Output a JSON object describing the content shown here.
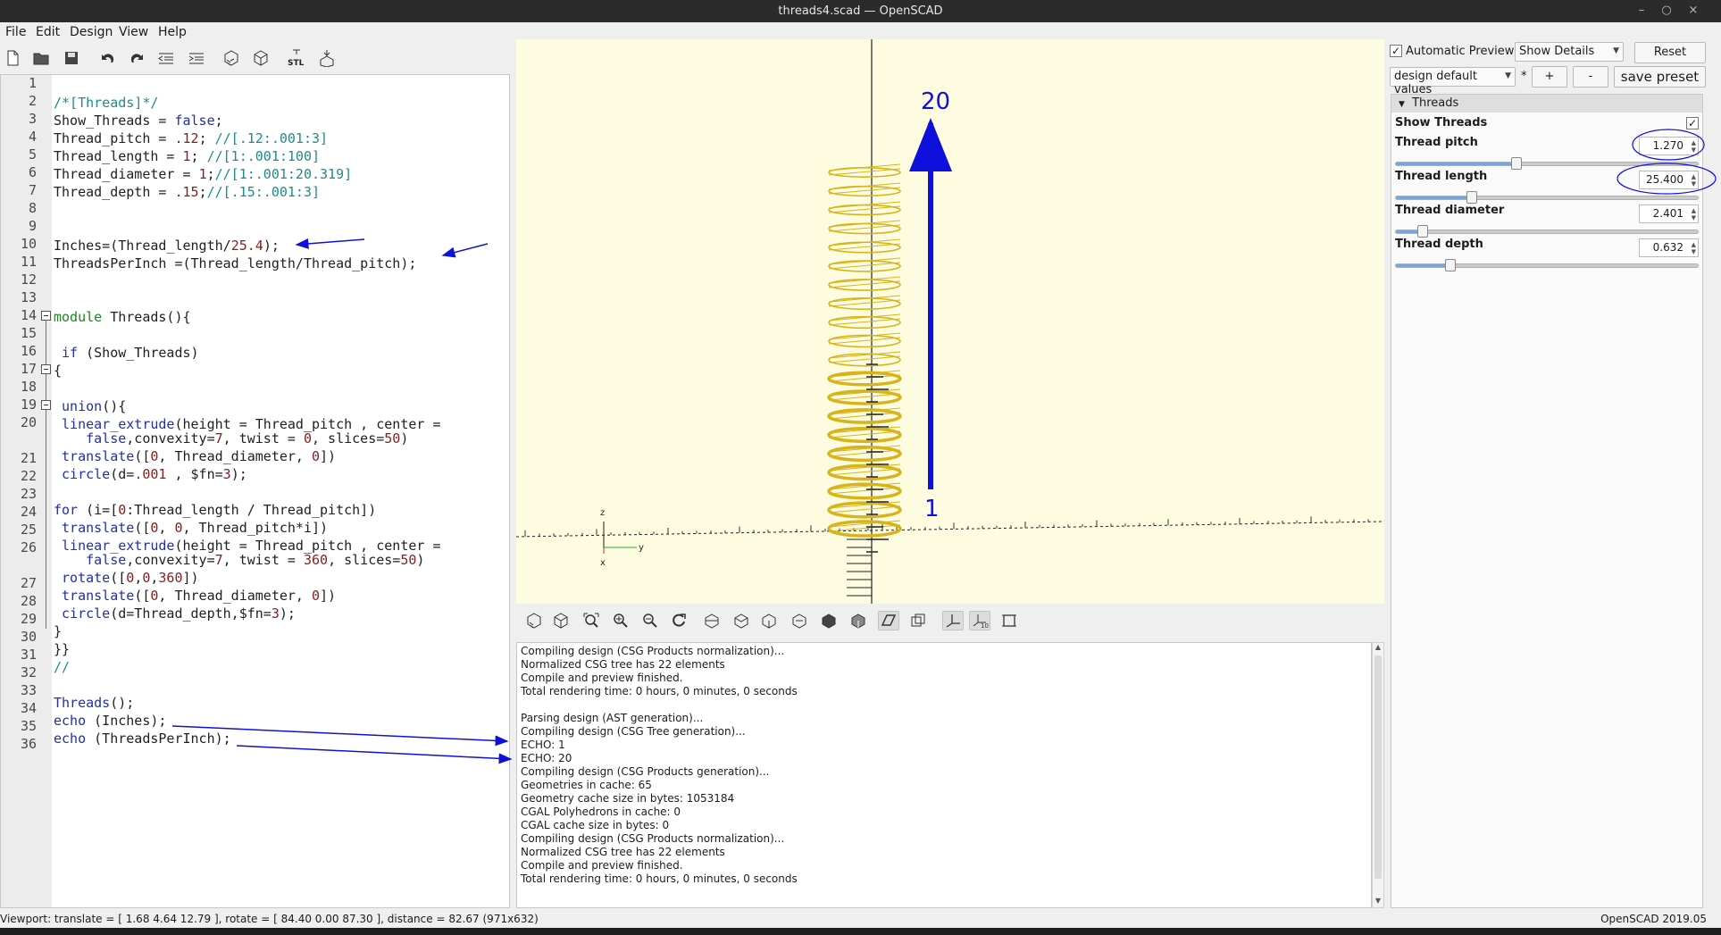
{
  "window": {
    "title": "threads4.scad — OpenSCAD"
  },
  "menu": [
    "File",
    "Edit",
    "Design",
    "View",
    "Help"
  ],
  "toolbar_icons": [
    "new-icon",
    "open-icon",
    "save-icon",
    "undo-icon",
    "redo-icon",
    "unindent-icon",
    "indent-icon",
    "preview-icon",
    "render-icon",
    "export-stl-icon",
    "send-to-print-icon"
  ],
  "toolbar_stl_label": "STL",
  "editor": {
    "line_numbers": [
      "1",
      "2",
      "3",
      "4",
      "5",
      "6",
      "7",
      "8",
      "9",
      "10",
      "11",
      "12",
      "13",
      "14",
      "15",
      "16",
      "17",
      "18",
      "19",
      "20",
      "21",
      "22",
      "23",
      "24",
      "25",
      "26",
      "27",
      "28",
      "29",
      "30",
      "31",
      "32",
      "33",
      "34",
      "35",
      "36"
    ]
  },
  "viewport": {
    "label_top": "20",
    "label_bottom": "1",
    "axis_z": "z",
    "axis_y": "y",
    "axis_x": "x"
  },
  "view_toolbar_icons": [
    "preview-icon",
    "render-icon",
    "view-all-icon",
    "zoom-in-icon",
    "zoom-out-icon",
    "reset-view-icon",
    "view-right-icon",
    "view-top-icon",
    "view-bottom-icon",
    "view-left-icon",
    "view-front-icon",
    "view-back-icon",
    "perspective-icon",
    "orthogonal-icon",
    "show-axes-icon",
    "show-scale-icon",
    "show-edges-icon"
  ],
  "view_toolbar_scale_label": "10",
  "console": {
    "lines": [
      "Compiling design (CSG Products normalization)...",
      "Normalized CSG tree has 22 elements",
      "Compile and preview finished.",
      "Total rendering time: 0 hours, 0 minutes, 0 seconds",
      "",
      "Parsing design (AST generation)...",
      "Compiling design (CSG Tree generation)...",
      "ECHO: 1",
      "ECHO: 20",
      "Compiling design (CSG Products generation)...",
      "Geometries in cache: 65",
      "Geometry cache size in bytes: 1053184",
      "CGAL Polyhedrons in cache: 0",
      "CGAL cache size in bytes: 0",
      "Compiling design (CSG Products normalization)...",
      "Normalized CSG tree has 22 elements",
      "Compile and preview finished.",
      "Total rendering time: 0 hours, 0 minutes, 0 seconds"
    ]
  },
  "customizer": {
    "auto_preview_label": "Automatic Preview",
    "auto_preview_checked": "✓",
    "details_select": "Show Details",
    "reset_label": "Reset",
    "preset_select": "design default values",
    "preset_modified": "*",
    "add_label": "+",
    "remove_label": "-",
    "save_preset_label": "save preset",
    "group_title": "Threads",
    "params": {
      "show_threads": {
        "label": "Show Threads",
        "checked": "✓"
      },
      "thread_pitch": {
        "label": "Thread pitch",
        "value": "1.270",
        "fraction": 0.4
      },
      "thread_length": {
        "label": "Thread length",
        "value": "25.400",
        "fraction": 0.25
      },
      "thread_diameter": {
        "label": "Thread diameter",
        "value": "2.401",
        "fraction": 0.09
      },
      "thread_depth": {
        "label": "Thread depth",
        "value": "0.632",
        "fraction": 0.18
      }
    }
  },
  "status": {
    "viewport_info": "Viewport: translate = [ 1.68 4.64 12.79 ], rotate = [ 84.40 0.00 87.30 ], distance = 82.67 (971x632)",
    "version": "OpenSCAD 2019.05"
  },
  "colors": {
    "annotation": "#1010dd",
    "thread": "#d8b41a",
    "viewport_bg": "#fdfbe0"
  }
}
